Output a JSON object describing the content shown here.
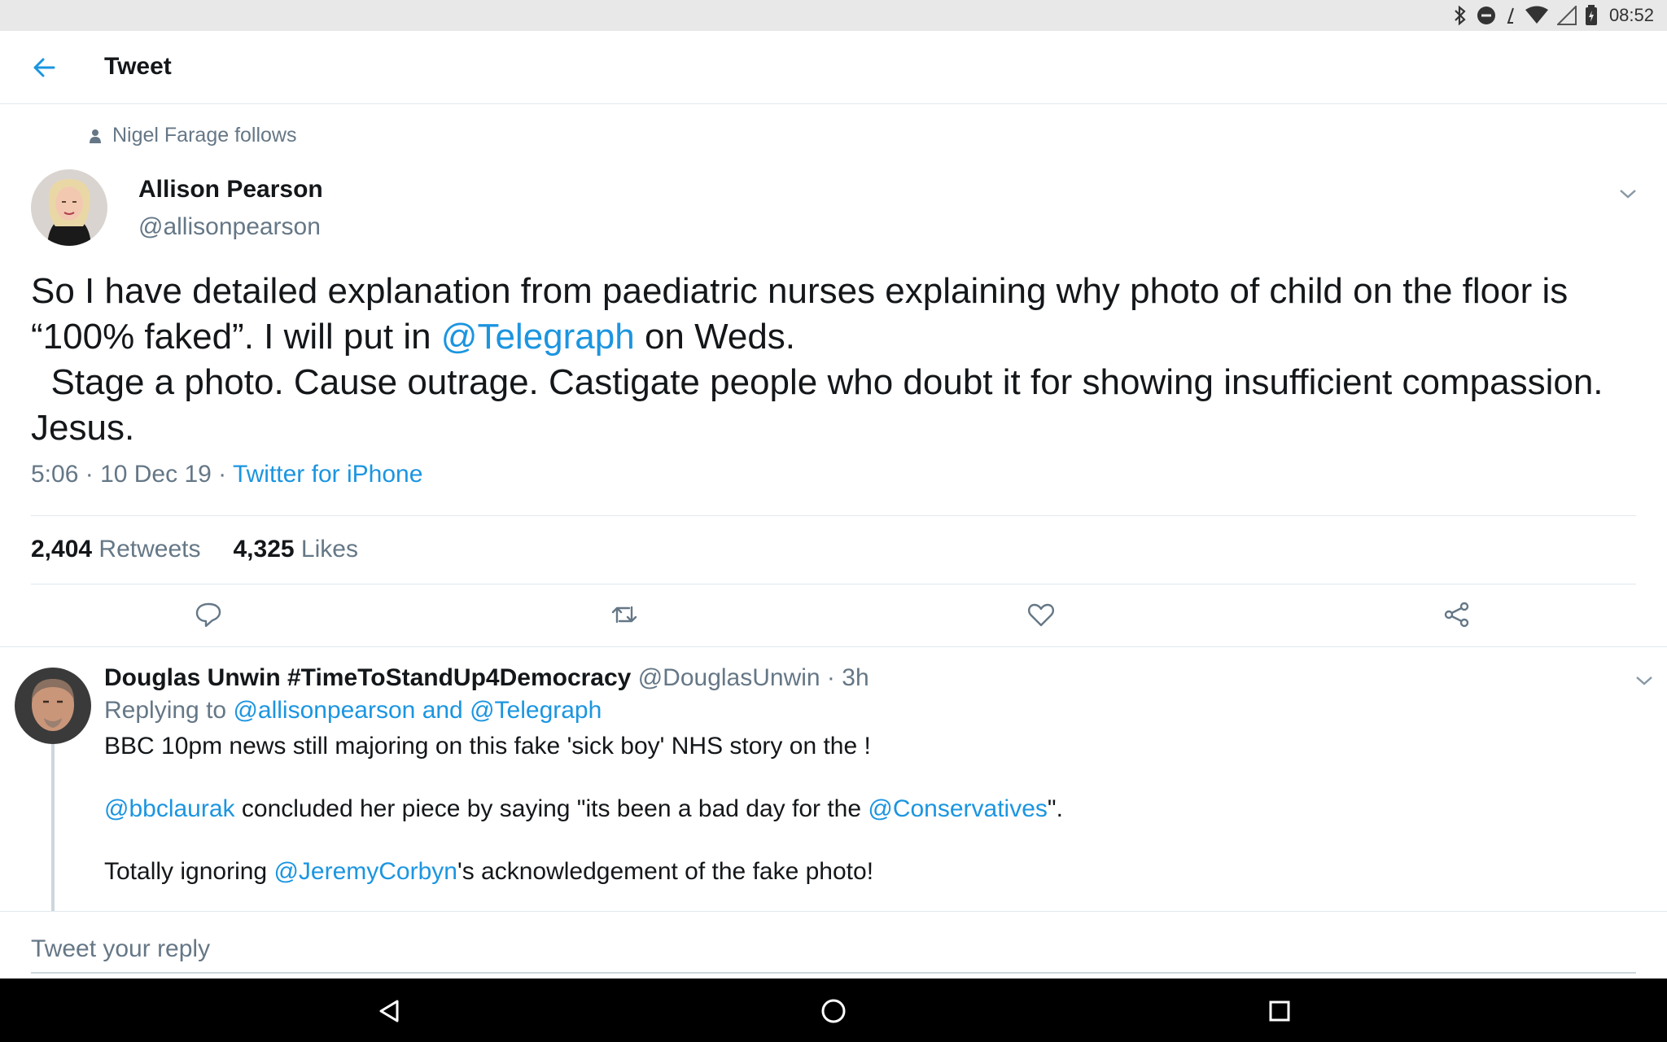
{
  "status_bar": {
    "time": "08:52"
  },
  "header": {
    "title": "Tweet"
  },
  "tweet": {
    "social_context": "Nigel Farage follows",
    "author_name": "Allison Pearson",
    "author_handle": "@allisonpearson",
    "text_part1": "So I have detailed explanation from paediatric nurses explaining why photo of child on the floor is “100% faked”. I will put in ",
    "text_mention": "@Telegraph",
    "text_part2": " on Weds.\n  Stage a photo. Cause outrage. Castigate people who doubt it for showing insufficient compassion. Jesus.",
    "time": "5:06",
    "date": "10 Dec 19",
    "source": "Twitter for iPhone",
    "retweets_count": "2,404",
    "retweets_label": "Retweets",
    "likes_count": "4,325",
    "likes_label": "Likes"
  },
  "reply": {
    "author_name": "Douglas Unwin #TimeToStandUp4Democracy",
    "author_handle": "@DouglasUnwin",
    "age": "3h",
    "replying_label": "Replying to ",
    "replying_to": "@allisonpearson and @Telegraph",
    "line1": "BBC 10pm news still majoring on this fake 'sick boy' NHS story on the !",
    "line2_mention1": "@bbclaurak",
    "line2_text": " concluded her piece by saying \"its been a bad day for the ",
    "line2_mention2": "@Conservatives",
    "line2_end": "\".",
    "line3_start": "Totally ignoring ",
    "line3_mention": "@JeremyCorbyn",
    "line3_end": "'s acknowledgement of the fake photo!"
  },
  "reply_box": {
    "placeholder": "Tweet your reply"
  },
  "colors": {
    "link": "#1b95e0",
    "secondary_text": "#657786",
    "divider": "#e1e8ed"
  },
  "icons": [
    "back-arrow-icon",
    "chevron-down-icon",
    "reply-icon",
    "retweet-icon",
    "like-icon",
    "share-icon",
    "person-icon",
    "bluetooth-icon",
    "dnd-icon",
    "wifi-icon",
    "signal-icon",
    "battery-icon",
    "nav-back-icon",
    "nav-home-icon",
    "nav-recents-icon"
  ]
}
